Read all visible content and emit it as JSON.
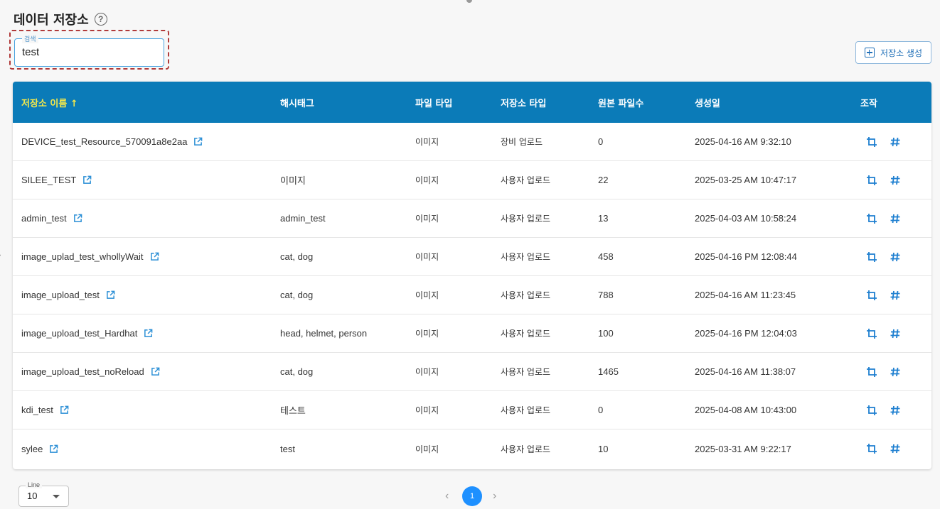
{
  "header": {
    "title": "데이터 저장소",
    "help_icon": "?"
  },
  "search": {
    "label": "검색",
    "value": "test"
  },
  "create_button": {
    "label": "저장소 생성",
    "icon": "plus-square-icon"
  },
  "table": {
    "columns": [
      "저장소 이름 ↑",
      "해시태그",
      "파일 타입",
      "저장소 타입",
      "원본 파일수",
      "생성일",
      "조작"
    ],
    "rows": [
      {
        "name": "DEVICE_test_Resource_570091a8e2aa",
        "hashtag": "",
        "file_type": "이미지",
        "repo_type": "장비 업로드",
        "count": "0",
        "created": "2025-04-16 AM 9:32:10"
      },
      {
        "name": "SILEE_TEST",
        "hashtag": "이미지",
        "file_type": "이미지",
        "repo_type": "사용자 업로드",
        "count": "22",
        "created": "2025-03-25 AM 10:47:17"
      },
      {
        "name": "admin_test",
        "hashtag": "admin_test",
        "file_type": "이미지",
        "repo_type": "사용자 업로드",
        "count": "13",
        "created": "2025-04-03 AM 10:58:24"
      },
      {
        "name": "image_uplad_test_whollyWait",
        "hashtag": "cat, dog",
        "file_type": "이미지",
        "repo_type": "사용자 업로드",
        "count": "458",
        "created": "2025-04-16 PM 12:08:44"
      },
      {
        "name": "image_upload_test",
        "hashtag": "cat, dog",
        "file_type": "이미지",
        "repo_type": "사용자 업로드",
        "count": "788",
        "created": "2025-04-16 AM 11:23:45"
      },
      {
        "name": "image_upload_test_Hardhat",
        "hashtag": "head, helmet, person",
        "file_type": "이미지",
        "repo_type": "사용자 업로드",
        "count": "100",
        "created": "2025-04-16 PM 12:04:03"
      },
      {
        "name": "image_upload_test_noReload",
        "hashtag": "cat, dog",
        "file_type": "이미지",
        "repo_type": "사용자 업로드",
        "count": "1465",
        "created": "2025-04-16 AM 11:38:07"
      },
      {
        "name": "kdi_test",
        "hashtag": "테스트",
        "file_type": "이미지",
        "repo_type": "사용자 업로드",
        "count": "0",
        "created": "2025-04-08 AM 10:43:00"
      },
      {
        "name": "sylee",
        "hashtag": "test",
        "file_type": "이미지",
        "repo_type": "사용자 업로드",
        "count": "10",
        "created": "2025-03-31 AM 9:22:17"
      }
    ]
  },
  "pagination": {
    "line_label": "Line",
    "line_value": "10",
    "current_page": "1",
    "prev": "‹",
    "next": "›"
  },
  "colors": {
    "header_bg": "#0b7bb8",
    "sorted_header": "#f5e94a",
    "accent": "#1e90ff"
  }
}
